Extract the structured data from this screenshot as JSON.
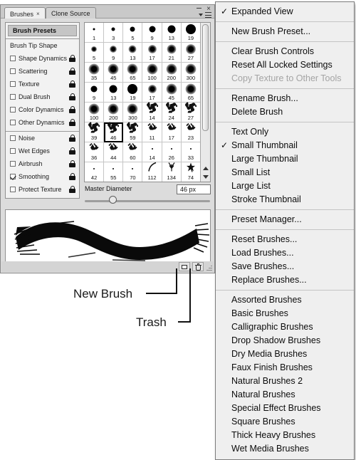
{
  "panel": {
    "tabs": [
      {
        "label": "Brushes",
        "active": true,
        "closable": true
      },
      {
        "label": "Clone Source",
        "active": false,
        "closable": false
      }
    ],
    "close_glyph": "×",
    "tab_close_glyph": "×",
    "options": {
      "presets_label": "Brush Presets",
      "tip_shape_label": "Brush Tip Shape",
      "group1": [
        {
          "label": "Shape Dynamics",
          "checked": false,
          "lock": true
        },
        {
          "label": "Scattering",
          "checked": false,
          "lock": true
        },
        {
          "label": "Texture",
          "checked": false,
          "lock": true
        },
        {
          "label": "Dual Brush",
          "checked": false,
          "lock": true
        },
        {
          "label": "Color Dynamics",
          "checked": false,
          "lock": true
        },
        {
          "label": "Other Dynamics",
          "checked": false,
          "lock": true
        }
      ],
      "group2": [
        {
          "label": "Noise",
          "checked": false,
          "lock": true
        },
        {
          "label": "Wet Edges",
          "checked": false,
          "lock": true
        },
        {
          "label": "Airbrush",
          "checked": false,
          "lock": true
        },
        {
          "label": "Smoothing",
          "checked": true,
          "lock": true
        },
        {
          "label": "Protect Texture",
          "checked": false,
          "lock": true
        }
      ]
    },
    "brush_grid": {
      "selected_size": 46,
      "rows": [
        [
          {
            "size": 1,
            "kind": "hard"
          },
          {
            "size": 3,
            "kind": "hard"
          },
          {
            "size": 5,
            "kind": "hard"
          },
          {
            "size": 9,
            "kind": "hard"
          },
          {
            "size": 13,
            "kind": "hard"
          },
          {
            "size": 19,
            "kind": "hard"
          }
        ],
        [
          {
            "size": 5,
            "kind": "soft"
          },
          {
            "size": 9,
            "kind": "soft"
          },
          {
            "size": 13,
            "kind": "soft"
          },
          {
            "size": 17,
            "kind": "soft"
          },
          {
            "size": 21,
            "kind": "soft"
          },
          {
            "size": 27,
            "kind": "soft"
          }
        ],
        [
          {
            "size": 35,
            "kind": "soft"
          },
          {
            "size": 45,
            "kind": "soft"
          },
          {
            "size": 65,
            "kind": "soft"
          },
          {
            "size": 100,
            "kind": "soft"
          },
          {
            "size": 200,
            "kind": "soft"
          },
          {
            "size": 300,
            "kind": "soft"
          }
        ],
        [
          {
            "size": 9,
            "kind": "hard"
          },
          {
            "size": 13,
            "kind": "hard"
          },
          {
            "size": 19,
            "kind": "hard"
          },
          {
            "size": 17,
            "kind": "soft"
          },
          {
            "size": 45,
            "kind": "soft"
          },
          {
            "size": 65,
            "kind": "soft"
          }
        ],
        [
          {
            "size": 100,
            "kind": "soft"
          },
          {
            "size": 200,
            "kind": "soft"
          },
          {
            "size": 300,
            "kind": "soft"
          },
          {
            "size": 14,
            "kind": "spatter"
          },
          {
            "size": 24,
            "kind": "spatter"
          },
          {
            "size": 27,
            "kind": "spatter"
          }
        ],
        [
          {
            "size": 39,
            "kind": "spatter"
          },
          {
            "size": 46,
            "kind": "spatter",
            "selected": true
          },
          {
            "size": 59,
            "kind": "spatter"
          },
          {
            "size": 11,
            "kind": "chalk"
          },
          {
            "size": 17,
            "kind": "chalk"
          },
          {
            "size": 23,
            "kind": "chalk"
          }
        ],
        [
          {
            "size": 36,
            "kind": "chalk"
          },
          {
            "size": 44,
            "kind": "chalk"
          },
          {
            "size": 60,
            "kind": "chalk"
          },
          {
            "size": 14,
            "kind": "tiny"
          },
          {
            "size": 26,
            "kind": "tiny"
          },
          {
            "size": 33,
            "kind": "tiny"
          }
        ],
        [
          {
            "size": 42,
            "kind": "tiny"
          },
          {
            "size": 55,
            "kind": "tiny"
          },
          {
            "size": 70,
            "kind": "tiny"
          },
          {
            "size": 112,
            "kind": "arc"
          },
          {
            "size": 134,
            "kind": "grass"
          },
          {
            "size": 74,
            "kind": "star"
          }
        ]
      ]
    },
    "master_diameter": {
      "label": "Master Diameter",
      "value": "46 px"
    },
    "footer": {
      "new_brush_tooltip": "New Brush",
      "trash_tooltip": "Trash"
    }
  },
  "callouts": [
    {
      "id": "new-brush",
      "label": "New Brush"
    },
    {
      "id": "trash",
      "label": "Trash"
    }
  ],
  "menu": {
    "check_glyph": "✓",
    "groups": [
      [
        {
          "label": "Expanded View",
          "checked": true,
          "disabled": false
        }
      ],
      [
        {
          "label": "New Brush Preset...",
          "checked": false,
          "disabled": false
        }
      ],
      [
        {
          "label": "Clear Brush Controls",
          "checked": false,
          "disabled": false
        },
        {
          "label": "Reset All Locked Settings",
          "checked": false,
          "disabled": false
        },
        {
          "label": "Copy Texture to Other Tools",
          "checked": false,
          "disabled": true
        }
      ],
      [
        {
          "label": "Rename Brush...",
          "checked": false,
          "disabled": false
        },
        {
          "label": "Delete Brush",
          "checked": false,
          "disabled": false
        }
      ],
      [
        {
          "label": "Text Only",
          "checked": false,
          "disabled": false
        },
        {
          "label": "Small Thumbnail",
          "checked": true,
          "disabled": false
        },
        {
          "label": "Large Thumbnail",
          "checked": false,
          "disabled": false
        },
        {
          "label": "Small List",
          "checked": false,
          "disabled": false
        },
        {
          "label": "Large List",
          "checked": false,
          "disabled": false
        },
        {
          "label": "Stroke Thumbnail",
          "checked": false,
          "disabled": false
        }
      ],
      [
        {
          "label": "Preset Manager...",
          "checked": false,
          "disabled": false
        }
      ],
      [
        {
          "label": "Reset Brushes...",
          "checked": false,
          "disabled": false
        },
        {
          "label": "Load Brushes...",
          "checked": false,
          "disabled": false
        },
        {
          "label": "Save Brushes...",
          "checked": false,
          "disabled": false
        },
        {
          "label": "Replace Brushes...",
          "checked": false,
          "disabled": false
        }
      ],
      [
        {
          "label": "Assorted Brushes",
          "checked": false,
          "disabled": false
        },
        {
          "label": "Basic Brushes",
          "checked": false,
          "disabled": false
        },
        {
          "label": "Calligraphic Brushes",
          "checked": false,
          "disabled": false
        },
        {
          "label": "Drop Shadow Brushes",
          "checked": false,
          "disabled": false
        },
        {
          "label": "Dry Media Brushes",
          "checked": false,
          "disabled": false
        },
        {
          "label": "Faux Finish Brushes",
          "checked": false,
          "disabled": false
        },
        {
          "label": "Natural Brushes 2",
          "checked": false,
          "disabled": false
        },
        {
          "label": "Natural Brushes",
          "checked": false,
          "disabled": false
        },
        {
          "label": "Special Effect Brushes",
          "checked": false,
          "disabled": false
        },
        {
          "label": "Square Brushes",
          "checked": false,
          "disabled": false
        },
        {
          "label": "Thick Heavy Brushes",
          "checked": false,
          "disabled": false
        },
        {
          "label": "Wet Media Brushes",
          "checked": false,
          "disabled": false
        }
      ]
    ]
  }
}
